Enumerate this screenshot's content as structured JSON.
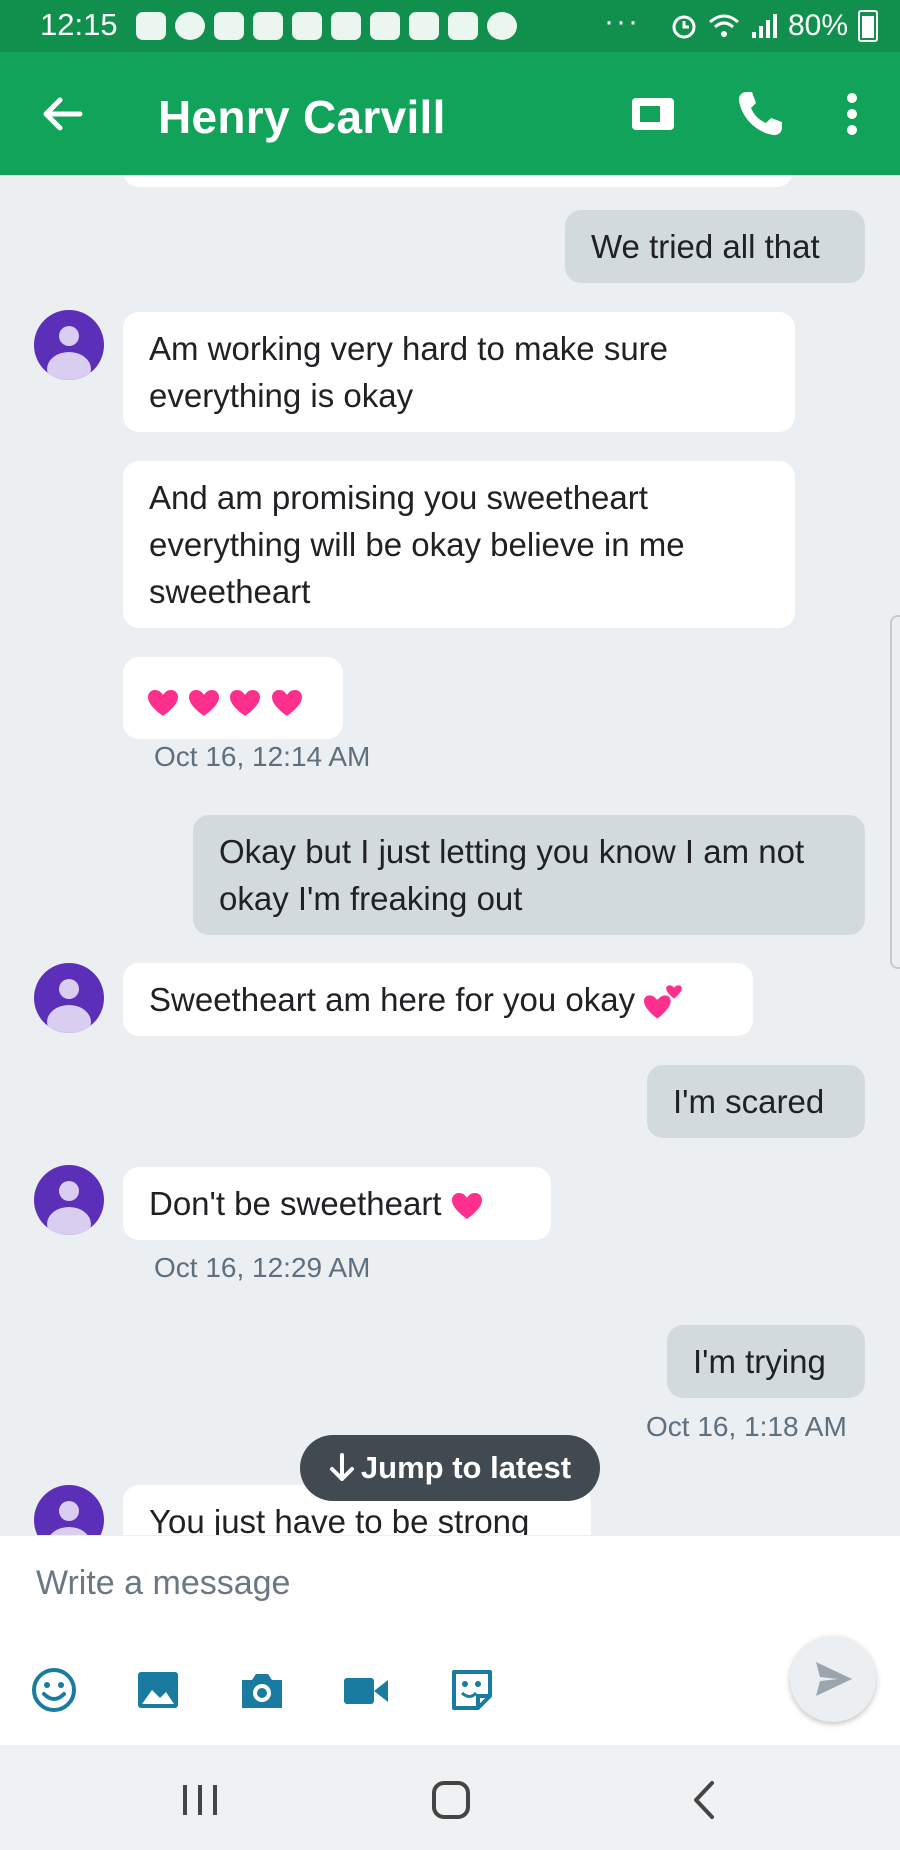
{
  "status_bar": {
    "time": "12:15",
    "dots": "···",
    "battery": "80%"
  },
  "app_bar": {
    "contact_name": "Henry Carvill"
  },
  "messages": [
    {
      "text": "We tried all that"
    },
    {
      "text": "Am working very hard to make sure everything is okay"
    },
    {
      "text": "And am promising you sweetheart everything will be okay believe in me sweetheart"
    },
    {
      "text": "Oct 16, 12:14 AM"
    },
    {
      "text": "Okay but I just letting you know I am not okay I'm freaking out"
    },
    {
      "text": "Sweetheart am here for you okay"
    },
    {
      "text": "I'm scared"
    },
    {
      "text": "Don't be sweetheart"
    },
    {
      "text": "Oct 16, 12:29 AM"
    },
    {
      "text": "I'm trying"
    },
    {
      "text": "Oct 16, 1:18 AM"
    },
    {
      "text": "You just have to be strong"
    }
  ],
  "jump_button": {
    "label": "Jump to latest"
  },
  "composer": {
    "placeholder": "Write a message"
  },
  "colors": {
    "status_bar": "#11904d",
    "app_bar": "#12a35a",
    "avatar": "#5b2fb8",
    "heart": "#ff2f8e"
  }
}
